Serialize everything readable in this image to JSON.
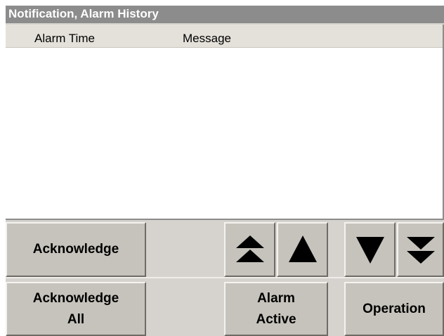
{
  "window": {
    "title": "Notification, Alarm History"
  },
  "alarm_list": {
    "columns": [
      "Alarm Time",
      "Message"
    ],
    "rows": []
  },
  "buttons": {
    "acknowledge": "Acknowledge",
    "acknowledge_all_line1": "Acknowledge",
    "acknowledge_all_line2": "All",
    "alarm_active_line1": "Alarm",
    "alarm_active_line2": "Active",
    "operation": "Operation"
  },
  "icons": {
    "page_up": "double-up-arrow",
    "line_up": "up-arrow",
    "line_down": "down-arrow",
    "page_down": "double-down-arrow"
  },
  "colors": {
    "title_bar": "#8c8c8c",
    "panel": "#d6d3ce",
    "button": "#c6c3bc"
  }
}
